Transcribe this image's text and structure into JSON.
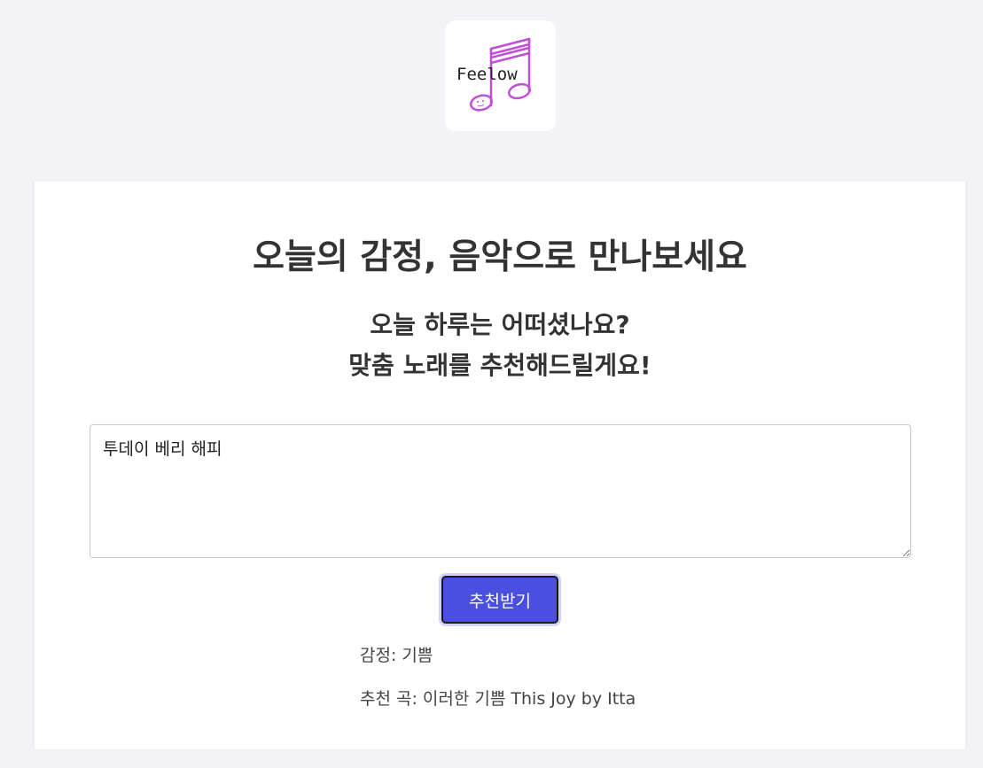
{
  "logo": {
    "text": "Feelow",
    "icon": "music-note-icon",
    "color": "#c04fd8"
  },
  "main": {
    "title": "오늘의 감정, 음악으로 만나보세요",
    "subtitle_line1": "오늘 하루는 어떠셨나요?",
    "subtitle_line2": "맞춤 노래를 추천해드릴게요!"
  },
  "input": {
    "value": "투데이 베리 해피",
    "placeholder": ""
  },
  "button": {
    "label": "추천받기",
    "color": "#4b4fe0"
  },
  "result": {
    "emotion_text": "감정: 기쁨",
    "song_text": "추천 곡: 이러한 기쁨 This Joy by Itta"
  }
}
